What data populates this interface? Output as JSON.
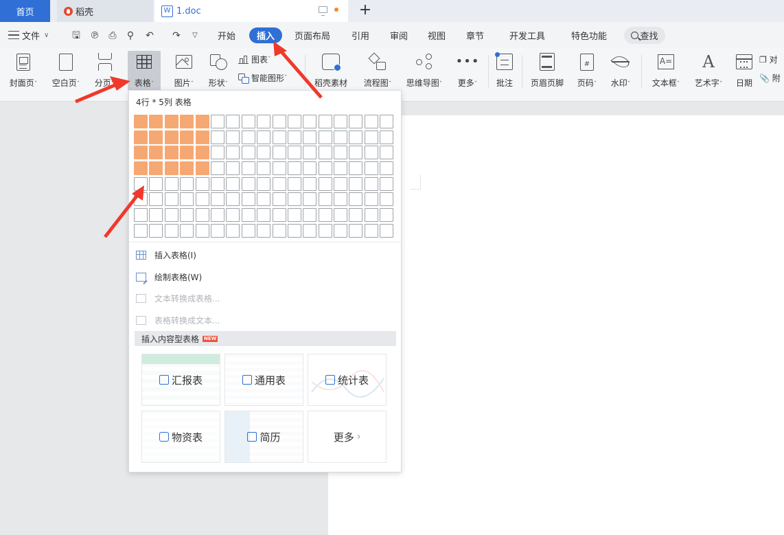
{
  "tabs": {
    "home": "首页",
    "daoke": "稻壳",
    "doc": "1.doc",
    "new_tab": "+"
  },
  "menubar": {
    "file": "文件",
    "items": [
      "开始",
      "插入",
      "页面布局",
      "引用",
      "审阅",
      "视图",
      "章节",
      "开发工具",
      "特色功能"
    ],
    "active": "插入",
    "search": "查找"
  },
  "ribbon": {
    "cover": "封面页",
    "blank": "空白页",
    "pagebreak": "分页",
    "table": "表格",
    "picture": "图片",
    "shape": "形状",
    "chart": "图表",
    "smartart": "智能图形",
    "material": "稻壳素材",
    "flowchart": "流程图",
    "mindmap": "思维导图",
    "more": "更多",
    "comment": "批注",
    "headerfooter": "页眉页脚",
    "pagenum": "页码",
    "watermark": "水印",
    "textbox": "文本框",
    "wordart": "艺术字",
    "date": "日期",
    "obj1": "对",
    "obj2": "附"
  },
  "table_picker": {
    "title": "4行 * 5列 表格",
    "rows": 8,
    "cols": 17,
    "selected_rows": 4,
    "selected_cols": 5
  },
  "table_menu": {
    "insert": "插入表格(I)",
    "draw": "绘制表格(W)",
    "text_to_table": "文本转换成表格...",
    "table_to_text": "表格转换成文本..."
  },
  "content_tables": {
    "header": "插入内容型表格",
    "badge": "NEW",
    "cards": [
      "汇报表",
      "通用表",
      "统计表",
      "物资表",
      "简历",
      "更多"
    ]
  },
  "colors": {
    "accent": "#2f6fd6",
    "selected_cell": "#f6a873",
    "annotation_arrow": "#f0392b"
  }
}
